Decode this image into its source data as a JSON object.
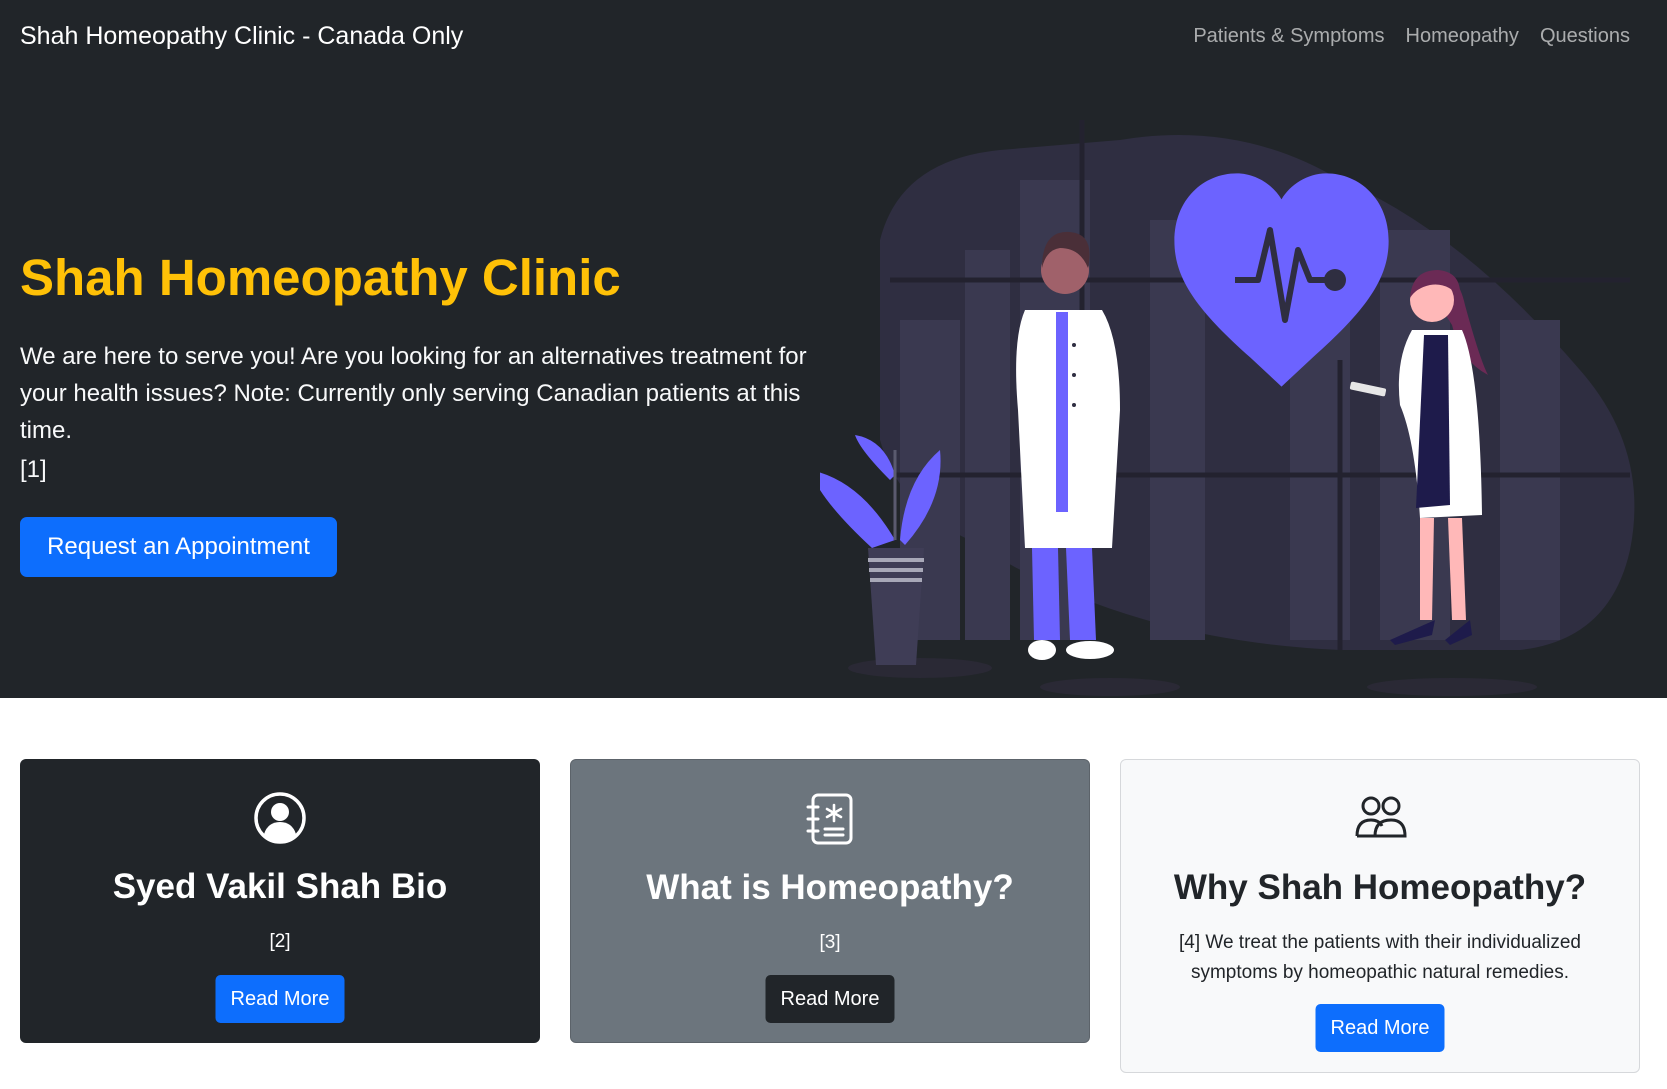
{
  "navbar": {
    "brand": "Shah Homeopathy Clinic - Canada Only",
    "links": [
      {
        "label": "Patients & Symptoms"
      },
      {
        "label": "Homeopathy"
      },
      {
        "label": "Questions"
      }
    ]
  },
  "hero": {
    "title": "Shah Homeopathy Clinic",
    "text": "We are here to serve you! Are you looking for an alternatives treatment for your health issues? Note: Currently only serving Canadian patients at this time.",
    "ref": "[1]",
    "cta_label": "Request an Appointment"
  },
  "cards": [
    {
      "title": "Syed Vakil Shah Bio",
      "text": "[2]",
      "button_label": "Read More",
      "icon": "person-circle-icon"
    },
    {
      "title": "What is Homeopathy?",
      "text": "[3]",
      "button_label": "Read More",
      "icon": "medical-journal-icon"
    },
    {
      "title": "Why Shah Homeopathy?",
      "text": "[4] We treat the patients with their individualized symptoms by homeopathic natural remedies.",
      "button_label": "Read More",
      "icon": "people-icon"
    }
  ],
  "colors": {
    "dark": "#212529",
    "secondary": "#6c757d",
    "light": "#f8f9fa",
    "primary": "#0d6efd",
    "warning": "#ffc107",
    "illustration_accent": "#6c63ff"
  }
}
